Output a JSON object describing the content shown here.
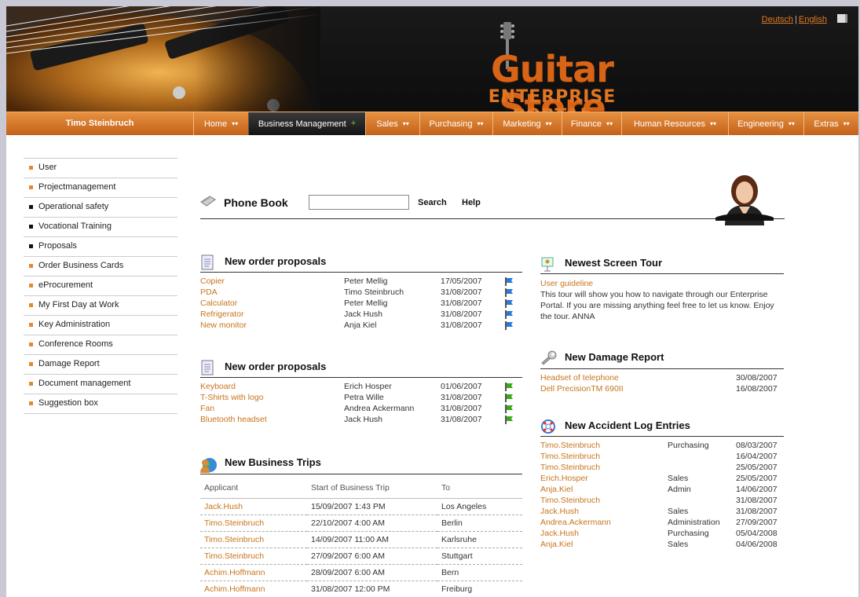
{
  "header": {
    "logo_title": "Guitar Store",
    "logo_subtitle": "ENTERPRISE PORTAL",
    "lang_de": "Deutsch",
    "lang_en": "English"
  },
  "nav": {
    "user": "Timo Steinbruch",
    "items": [
      {
        "label": "Home"
      },
      {
        "label": "Business Management"
      },
      {
        "label": "Sales"
      },
      {
        "label": "Purchasing"
      },
      {
        "label": "Marketing"
      },
      {
        "label": "Finance"
      },
      {
        "label": "Human Resources"
      },
      {
        "label": "Engineering"
      },
      {
        "label": "Extras"
      }
    ]
  },
  "sidebar": {
    "items": [
      {
        "label": "User",
        "bullet": "orange"
      },
      {
        "label": "Projectmanagement",
        "bullet": "orange"
      },
      {
        "label": "Operational safety",
        "bullet": "black"
      },
      {
        "label": "Vocational Training",
        "bullet": "black"
      },
      {
        "label": "Proposals",
        "bullet": "black"
      },
      {
        "label": "Order Business Cards",
        "bullet": "orange"
      },
      {
        "label": "eProcurement",
        "bullet": "orange"
      },
      {
        "label": "My First Day at Work",
        "bullet": "orange"
      },
      {
        "label": "Key Administration",
        "bullet": "orange"
      },
      {
        "label": "Conference Rooms",
        "bullet": "orange"
      },
      {
        "label": "Damage Report",
        "bullet": "orange"
      },
      {
        "label": "Document management",
        "bullet": "orange"
      },
      {
        "label": "Suggestion box",
        "bullet": "orange"
      }
    ]
  },
  "phonebook": {
    "title": "Phone Book",
    "input_value": "",
    "search_label": "Search",
    "help_label": "Help"
  },
  "order_proposals_1": {
    "title": "New order proposals",
    "rows": [
      {
        "item": "Copier",
        "person": "Peter Mellig",
        "date": "17/05/2007",
        "flag": "blue"
      },
      {
        "item": "PDA",
        "person": "Timo Steinbruch",
        "date": "31/08/2007",
        "flag": "blue"
      },
      {
        "item": "Calculator",
        "person": "Peter Mellig",
        "date": "31/08/2007",
        "flag": "blue"
      },
      {
        "item": "Refrigerator",
        "person": "Jack Hush",
        "date": "31/08/2007",
        "flag": "blue"
      },
      {
        "item": "New monitor",
        "person": "Anja Kiel",
        "date": "31/08/2007",
        "flag": "blue"
      }
    ]
  },
  "order_proposals_2": {
    "title": "New order proposals",
    "rows": [
      {
        "item": "Keyboard",
        "person": "Erich Hosper",
        "date": "01/06/2007",
        "flag": "green"
      },
      {
        "item": "T-Shirts with logo",
        "person": "Petra Wille",
        "date": "31/08/2007",
        "flag": "green"
      },
      {
        "item": "Fan",
        "person": "Andrea Ackermann",
        "date": "31/08/2007",
        "flag": "green"
      },
      {
        "item": "Bluetooth headset",
        "person": "Jack Hush",
        "date": "31/08/2007",
        "flag": "green"
      }
    ]
  },
  "business_trips": {
    "title": "New Business Trips",
    "headers": [
      "Applicant",
      "Start of Business Trip",
      "To"
    ],
    "rows": [
      [
        "Jack.Hush",
        "15/09/2007 1:43 PM",
        "Los Angeles"
      ],
      [
        "Timo.Steinbruch",
        "22/10/2007 4:00 AM",
        "Berlin"
      ],
      [
        "Timo.Steinbruch",
        "14/09/2007 11:00 AM",
        "Karlsruhe"
      ],
      [
        "Timo.Steinbruch",
        "27/09/2007 6:00 AM",
        "Stuttgart"
      ],
      [
        "Achim.Hoffmann",
        "28/09/2007 6:00 AM",
        "Bern"
      ],
      [
        "Achim.Hoffmann",
        "31/08/2007 12:00 PM",
        "Freiburg"
      ]
    ]
  },
  "screen_tour": {
    "title": "Newest Screen Tour",
    "link": "User guideline",
    "text": "This tour will show you how to navigate through our Enterprise Portal. If you are missing anything feel free to let us know. Enjoy the tour. ANNA"
  },
  "damage_report": {
    "title": "New Damage Report",
    "rows": [
      {
        "item": "Headset of telephone",
        "date": "30/08/2007"
      },
      {
        "item": "Dell PrecisionTM 690II",
        "date": "16/08/2007"
      }
    ]
  },
  "accident_log": {
    "title": "New Accident Log Entries",
    "rows": [
      {
        "name": "Timo.Steinbruch",
        "dept": "Purchasing",
        "date": "08/03/2007"
      },
      {
        "name": "Timo.Steinbruch",
        "dept": "",
        "date": "16/04/2007"
      },
      {
        "name": "Timo.Steinbruch",
        "dept": "",
        "date": "25/05/2007"
      },
      {
        "name": "Erich.Hosper",
        "dept": "Sales",
        "date": "25/05/2007"
      },
      {
        "name": "Anja.Kiel",
        "dept": "Admin",
        "date": "14/06/2007"
      },
      {
        "name": "Timo.Steinbruch",
        "dept": "",
        "date": "31/08/2007"
      },
      {
        "name": "Jack.Hush",
        "dept": "Sales",
        "date": "31/08/2007"
      },
      {
        "name": "Andrea.Ackermann",
        "dept": "Administration",
        "date": "27/09/2007"
      },
      {
        "name": "Jack.Hush",
        "dept": "Purchasing",
        "date": "05/04/2008"
      },
      {
        "name": "Anja.Kiel",
        "dept": "Sales",
        "date": "04/06/2008"
      }
    ]
  },
  "colors": {
    "accent": "#c8741c",
    "nav_orange": "#d87a2a",
    "flag_blue": "#2a7ad8",
    "flag_green": "#3aa81a"
  }
}
